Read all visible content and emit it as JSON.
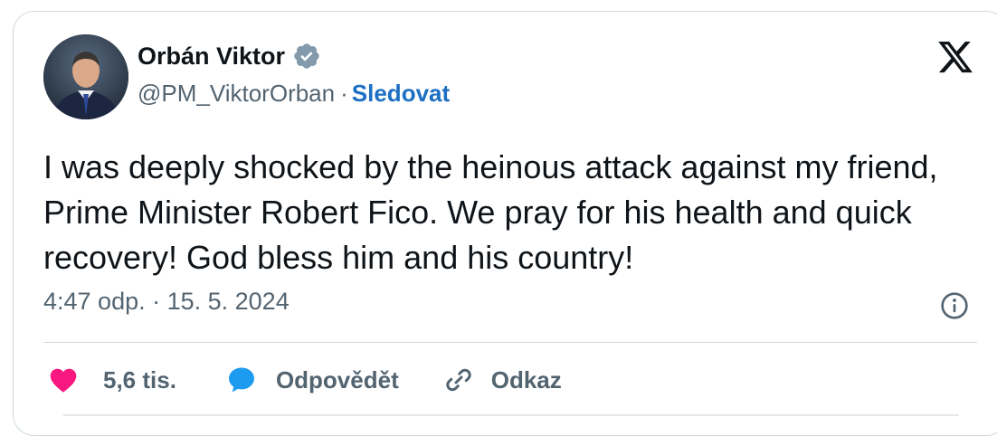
{
  "author": {
    "name": "Orbán Viktor",
    "handle": "@PM_ViktorOrban",
    "separator": "·",
    "follow_label": "Sledovat",
    "verified_color": "#829aab"
  },
  "platform_icon": "x-logo",
  "tweet": {
    "text": "I was deeply shocked by the heinous attack against my friend, Prime Minister Robert Fico. We pray for his health and quick recovery! God bless him and his country!",
    "timestamp": "4:47 odp. · 15. 5. 2024"
  },
  "actions": {
    "like": {
      "icon": "heart-icon",
      "label": "5,6 tis.",
      "color": "#f91880"
    },
    "reply": {
      "icon": "speech-bubble-icon",
      "label": "Odpovědět",
      "color": "#1d9bf0"
    },
    "link": {
      "icon": "link-icon",
      "label": "Odkaz"
    }
  },
  "colors": {
    "text": "#0f1419",
    "secondary": "#536471",
    "accent": "#1d6fc2",
    "border": "#cfd9de"
  }
}
